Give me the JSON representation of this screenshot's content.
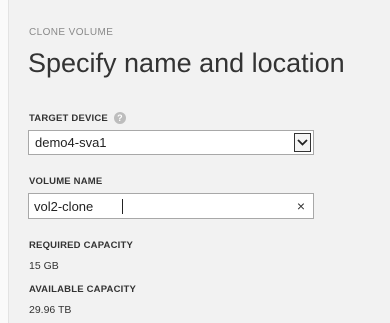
{
  "wizard": {
    "label": "CLONE VOLUME",
    "title": "Specify name and location"
  },
  "target_device": {
    "label": "TARGET DEVICE",
    "help_icon": "?",
    "selected": "demo4-sva1"
  },
  "volume_name": {
    "label": "VOLUME NAME",
    "value": "vol2-clone",
    "clear_icon": "×"
  },
  "required_capacity": {
    "label": "REQUIRED CAPACITY",
    "value": "15 GB"
  },
  "available_capacity": {
    "label": "AVAILABLE CAPACITY",
    "value": "29.96 TB"
  }
}
